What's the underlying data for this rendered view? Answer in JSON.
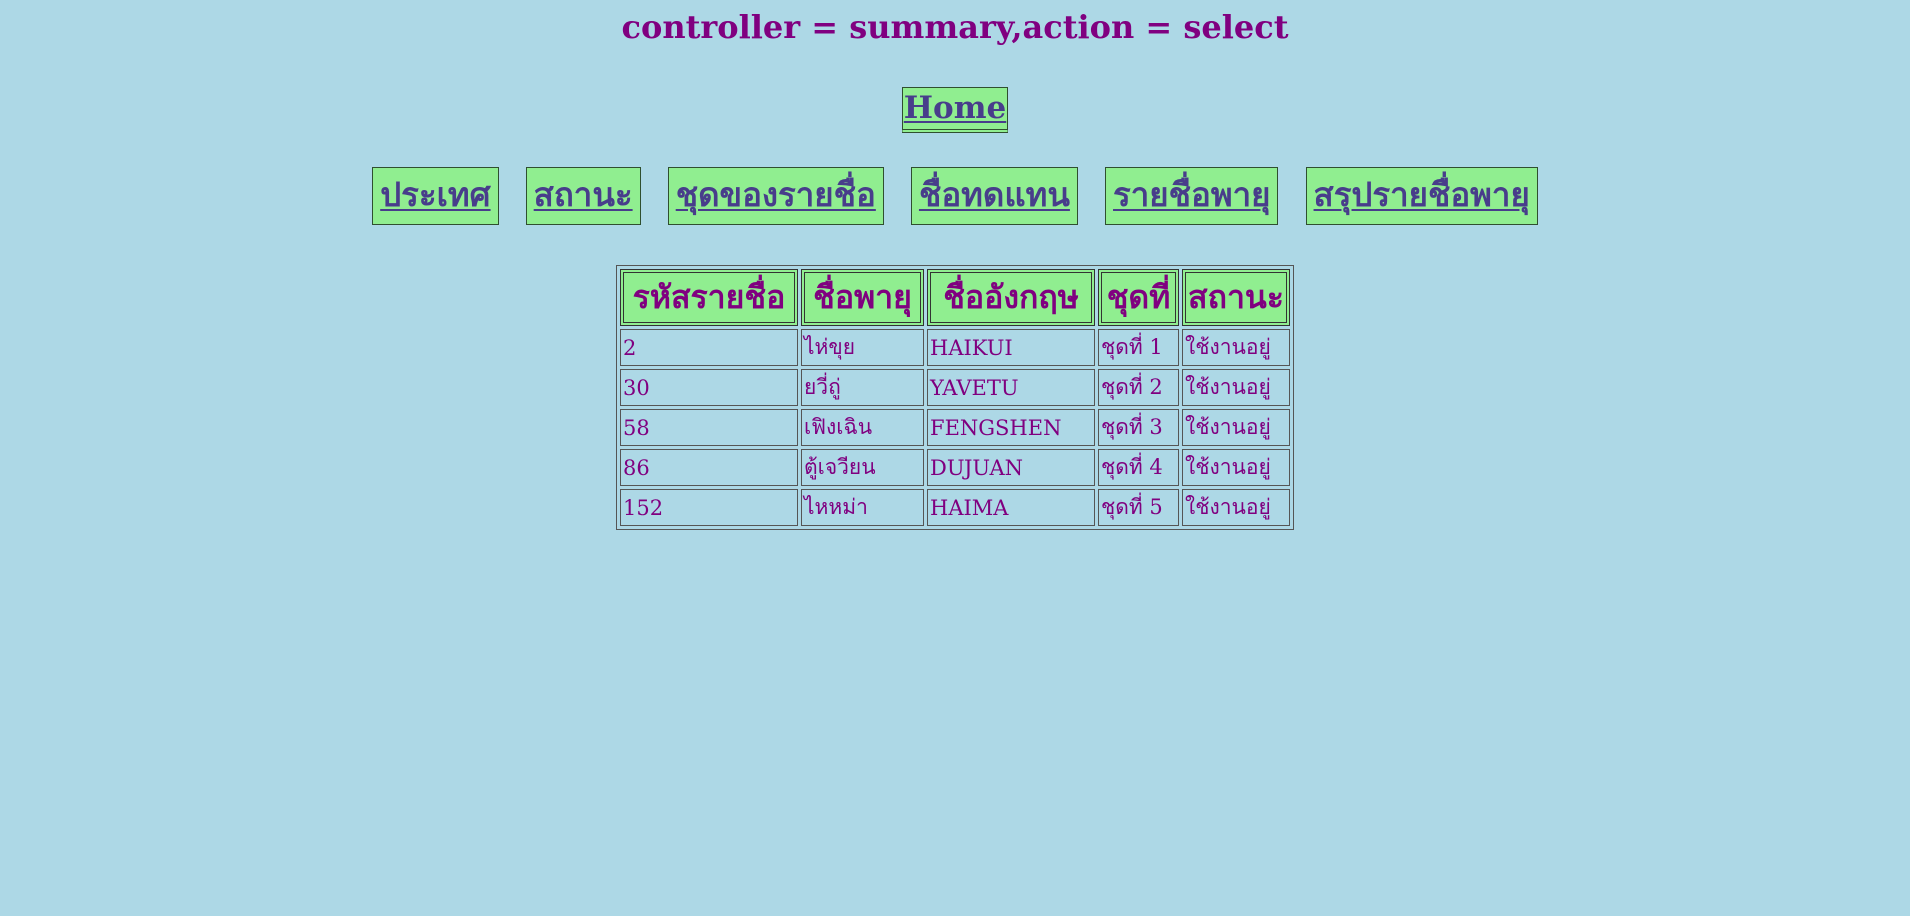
{
  "page": {
    "title": "controller = summary,action = select"
  },
  "nav": {
    "home": "Home",
    "items": [
      {
        "label": "ประเทศ"
      },
      {
        "label": "สถานะ"
      },
      {
        "label": "ชุดของรายชื่อ"
      },
      {
        "label": "ชื่อทดแทน"
      },
      {
        "label": "รายชื่อพายุ"
      },
      {
        "label": "สรุปรายชื่อพายุ"
      }
    ]
  },
  "table": {
    "headers": [
      "รหัสรายชื่อ",
      "ชื่อพายุ",
      "ชื่ออังกฤษ",
      "ชุดที่",
      "สถานะ"
    ],
    "rows": [
      [
        "2",
        "ไห่ขุย",
        "HAIKUI",
        "ชุดที่ 1",
        "ใช้งานอยู่"
      ],
      [
        "30",
        "ยวี่ถู่",
        "YAVETU",
        "ชุดที่ 2",
        "ใช้งานอยู่"
      ],
      [
        "58",
        "เฟิงเฉิน",
        "FENGSHEN",
        "ชุดที่ 3",
        "ใช้งานอยู่"
      ],
      [
        "86",
        "ตู้เจวียน",
        "DUJUAN",
        "ชุดที่ 4",
        "ใช้งานอยู่"
      ],
      [
        "152",
        "ไหหม่า",
        "HAIMA",
        "ชุดที่ 5",
        "ใช้งานอยู่"
      ]
    ]
  },
  "colors": {
    "background": "#add8e6",
    "button": "#90ee90",
    "text": "#800080",
    "link": "#483d8b"
  }
}
